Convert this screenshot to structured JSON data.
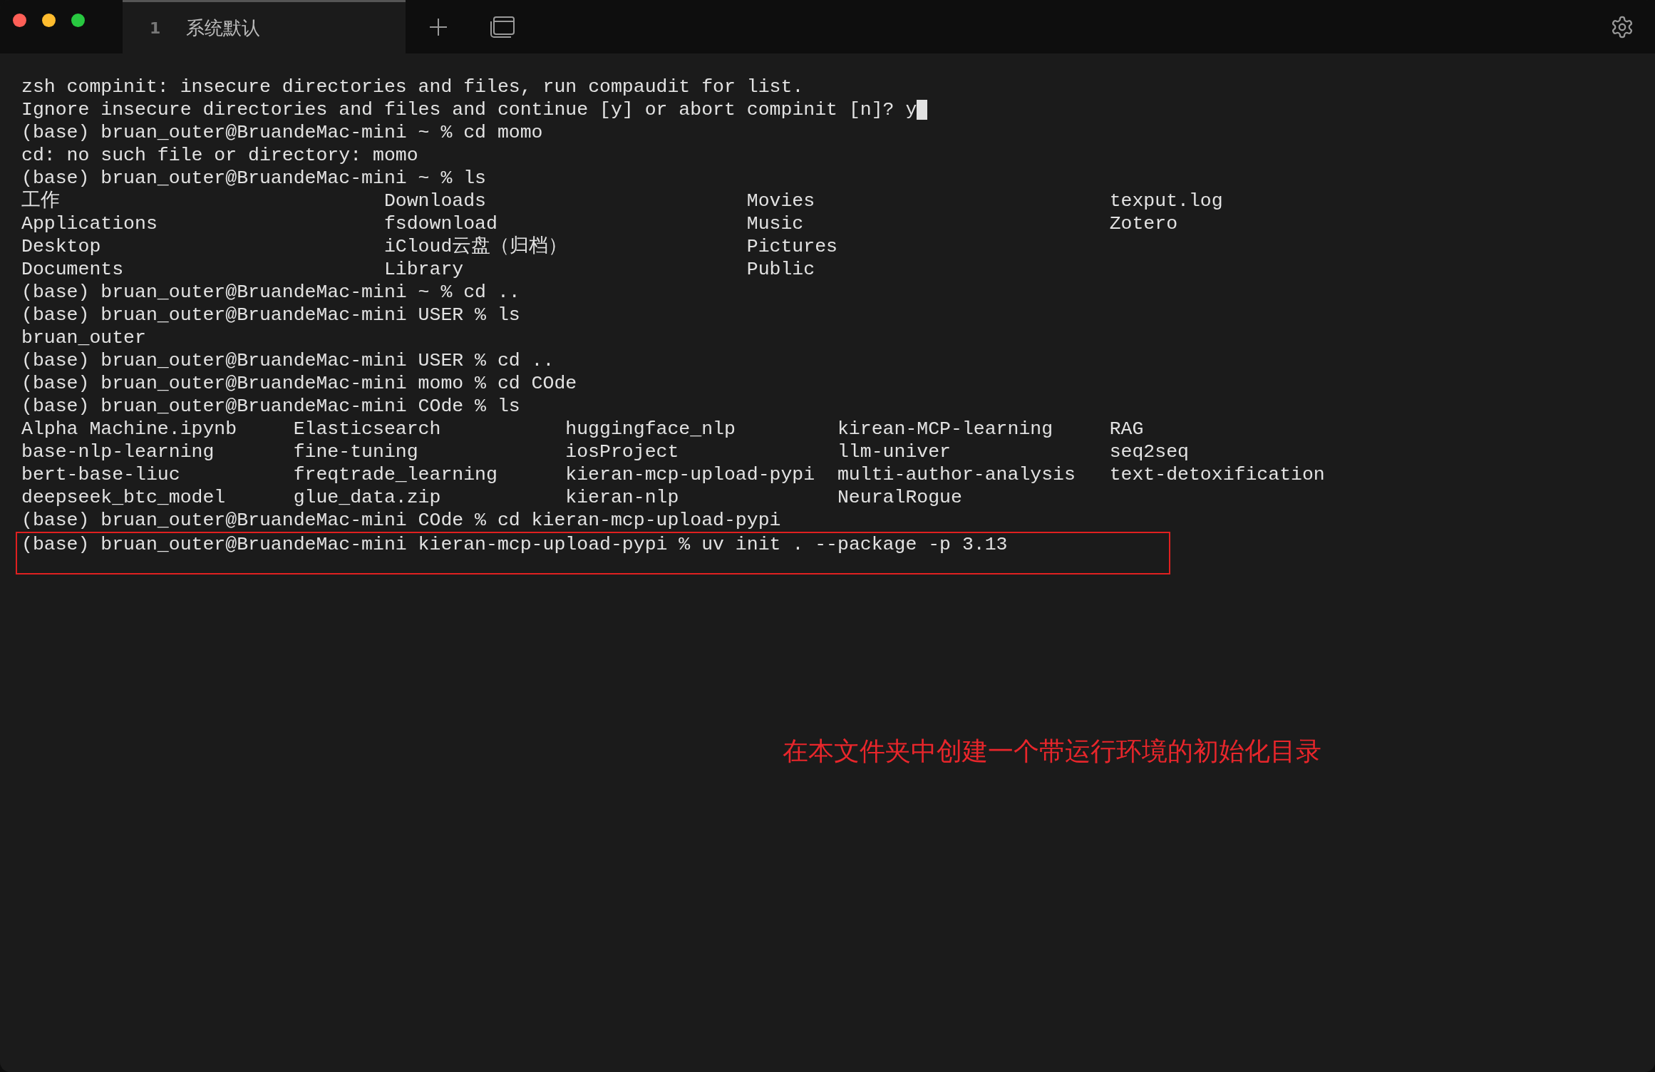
{
  "tabs": [
    {
      "number": "1",
      "label": "系统默认",
      "selected": true
    }
  ],
  "lines": [
    {
      "kind": "text",
      "text": "zsh compinit: insecure directories and files, run compaudit for list.",
      "cursor": false,
      "highlighted": false
    },
    {
      "kind": "text",
      "text": "Ignore insecure directories and files and continue [y] or abort compinit [n]? y",
      "cursor": true,
      "highlighted": false
    },
    {
      "kind": "text",
      "text": "(base) bruan_outer@BruandeMac-mini ~ % cd momo",
      "cursor": false,
      "highlighted": false
    },
    {
      "kind": "text",
      "text": "cd: no such file or directory: momo",
      "cursor": false,
      "highlighted": false
    },
    {
      "kind": "text",
      "text": "(base) bruan_outer@BruandeMac-mini ~ % ls",
      "cursor": false,
      "highlighted": false
    },
    {
      "kind": "listing",
      "rows": [
        [
          "工作",
          "Downloads",
          "Movies",
          "texput.log"
        ],
        [
          "Applications",
          "fsdownload",
          "Music",
          "Zotero"
        ],
        [
          "Desktop",
          "iCloud云盘（归档）",
          "Pictures"
        ],
        [
          "Documents",
          "Library",
          "Public"
        ]
      ]
    },
    {
      "kind": "text",
      "text": "(base) bruan_outer@BruandeMac-mini ~ % cd ..",
      "cursor": false,
      "highlighted": false
    },
    {
      "kind": "text",
      "text": "(base) bruan_outer@BruandeMac-mini USER % ls",
      "cursor": false,
      "highlighted": false
    },
    {
      "kind": "text",
      "text": "bruan_outer",
      "cursor": false,
      "highlighted": false
    },
    {
      "kind": "text",
      "text": "(base) bruan_outer@BruandeMac-mini USER % cd ..",
      "cursor": false,
      "highlighted": false
    },
    {
      "kind": "text",
      "text": "(base) bruan_outer@BruandeMac-mini momo % cd COde",
      "cursor": false,
      "highlighted": false
    },
    {
      "kind": "text",
      "text": "(base) bruan_outer@BruandeMac-mini COde % ls",
      "cursor": false,
      "highlighted": false
    },
    {
      "kind": "listing",
      "rows": [
        [
          "Alpha Machine.ipynb",
          "Elasticsearch",
          "huggingface_nlp",
          "kirean-MCP-learning",
          "RAG"
        ],
        [
          "base-nlp-learning",
          "fine-tuning",
          "iosProject",
          "llm-univer",
          "seq2seq"
        ],
        [
          "bert-base-liuc",
          "freqtrade_learning",
          "kieran-mcp-upload-pypi",
          "multi-author-analysis",
          "text-detoxification"
        ],
        [
          "deepseek_btc_model",
          "glue_data.zip",
          "kieran-nlp",
          "NeuralRogue"
        ]
      ]
    },
    {
      "kind": "text",
      "text": "(base) bruan_outer@BruandeMac-mini COde % cd kieran-mcp-upload-pypi",
      "cursor": false,
      "highlighted": false
    },
    {
      "kind": "text",
      "text": "(base) bruan_outer@BruandeMac-mini kieran-mcp-upload-pypi % uv init . --package -p 3.13",
      "cursor": false,
      "highlighted": true
    }
  ],
  "annotation": "在本文件夹中创建一个带运行环境的初始化目录"
}
